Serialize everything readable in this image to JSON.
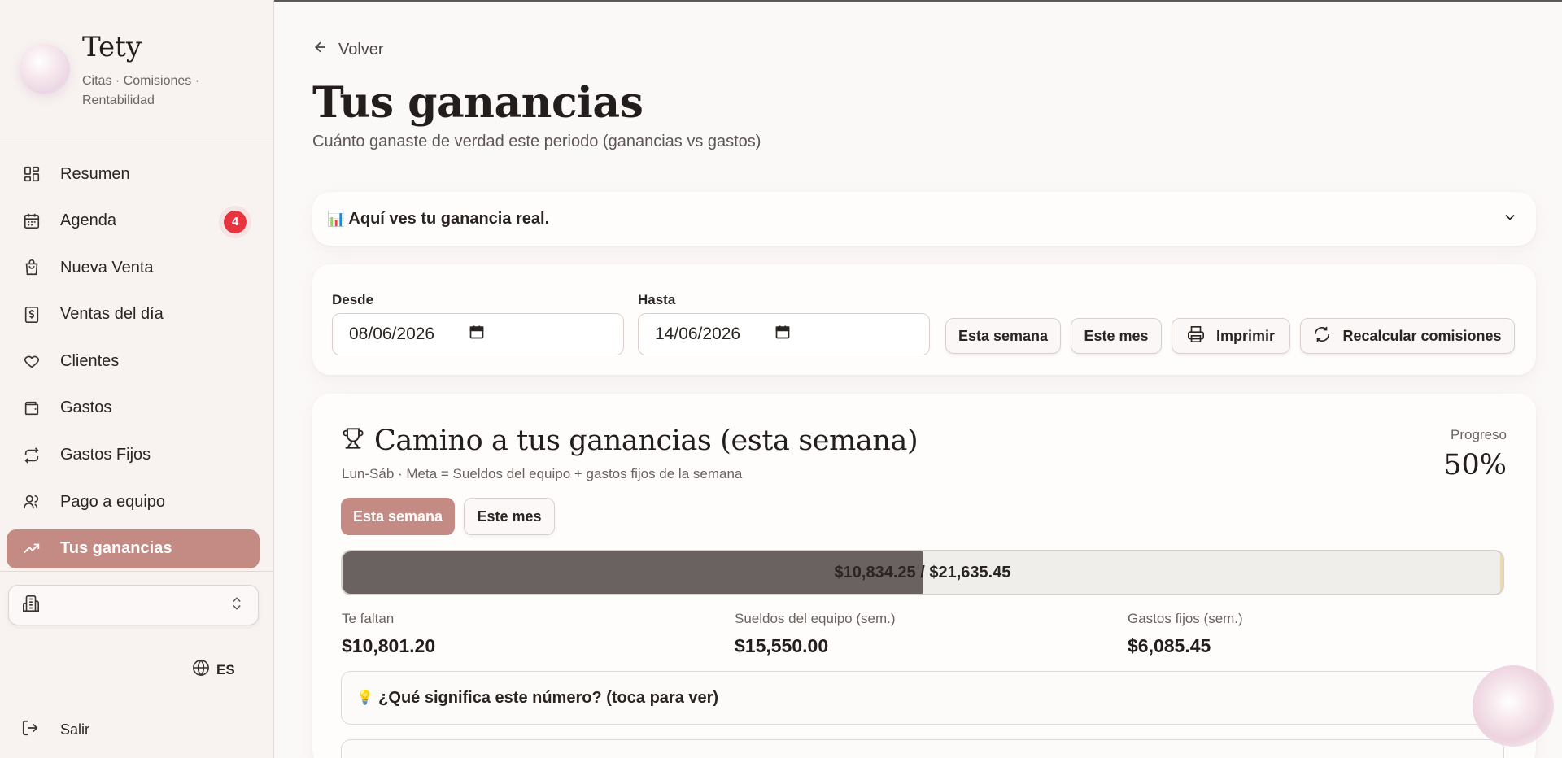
{
  "brand": {
    "name": "Tety",
    "subtitle": "Citas · Comisiones · Rentabilidad"
  },
  "sidebar": {
    "items": [
      {
        "label": "Resumen",
        "icon": "dashboard-icon"
      },
      {
        "label": "Agenda",
        "icon": "calendar-icon",
        "badge": "4"
      },
      {
        "label": "Nueva Venta",
        "icon": "shopping-bag-icon"
      },
      {
        "label": "Ventas del día",
        "icon": "receipt-dollar-icon"
      },
      {
        "label": "Clientes",
        "icon": "heart-icon"
      },
      {
        "label": "Gastos",
        "icon": "wallet-icon"
      },
      {
        "label": "Gastos Fijos",
        "icon": "repeat-icon"
      },
      {
        "label": "Pago a equipo",
        "icon": "users-icon"
      },
      {
        "label": "Tus ganancias",
        "icon": "trending-up-icon",
        "active": true
      }
    ],
    "language": "ES",
    "logout": "Salir"
  },
  "header": {
    "back": "Volver",
    "title": "Tus ganancias",
    "subtitle": "Cuánto ganaste de verdad este periodo (ganancias vs gastos)"
  },
  "info_panel": {
    "emoji": "📊",
    "text": "Aquí ves tu ganancia real."
  },
  "filters": {
    "from_label": "Desde",
    "from_value": "08/06/2026",
    "to_label": "Hasta",
    "to_value": "14/06/2026",
    "week_button": "Esta semana",
    "month_button": "Este mes",
    "print_button": "Imprimir",
    "recalc_button": "Recalcular comisiones"
  },
  "goal": {
    "title": "Camino a tus ganancias (esta semana)",
    "subtitle": "Lun-Sáb · Meta = Sueldos del equipo + gastos fijos de la semana",
    "progress_label": "Progreso",
    "progress_value": "50%",
    "progress_fraction": 0.5,
    "toggle_week": "Esta semana",
    "toggle_month": "Este mes",
    "current": "$10,834.25",
    "separator": " / ",
    "target": "$21,635.45",
    "remaining_label": "Te faltan",
    "remaining_value": "$10,801.20",
    "salaries_label": "Sueldos del equipo (sem.)",
    "salaries_value": "$15,550.00",
    "fixed_label": "Gastos fijos (sem.)",
    "fixed_value": "$6,085.45",
    "explain_emoji": "💡",
    "explain_text": "¿Qué significa este número? (toca para ver)"
  },
  "colors": {
    "accent": "#c48a84",
    "badge": "#e7343f",
    "bar_fill": "#696260",
    "background": "#fbf9f8"
  }
}
